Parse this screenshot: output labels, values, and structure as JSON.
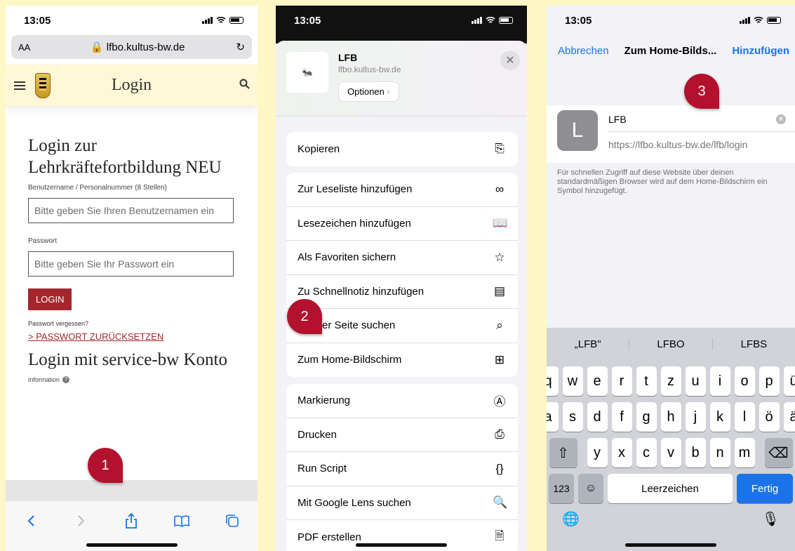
{
  "panel1": {
    "time": "13:05",
    "aa": "AA",
    "url": "lfbo.kultus-bw.de",
    "page_title": "Login",
    "heading": "Login zur Lehrkräftefortbildung NEU",
    "username_label": "Benutzername / Personalnummer (8 Stellen)",
    "username_placeholder": "Bitte geben Sie Ihren Benutzernamen ein",
    "password_label": "Passwort",
    "password_placeholder": "Bitte geben Sie Ihr Passwort ein",
    "login_button": "LOGIN",
    "forgot": "Passwort vergessen?",
    "reset_link": "> PASSWORT ZURÜCKSETZEN",
    "heading2": "Login mit service-bw Konto",
    "info": "Information",
    "badge": "1"
  },
  "panel2": {
    "time": "13:05",
    "site_title": "LFB",
    "site_url": "lfbo.kultus-bw.de",
    "options": "Optionen",
    "close": "✕",
    "group1": [
      {
        "label": "Kopieren",
        "icon": "copy-icon"
      }
    ],
    "group2": [
      {
        "label": "Zur Leseliste hinzufügen",
        "icon": "glasses-icon"
      },
      {
        "label": "Lesezeichen hinzufügen",
        "icon": "book-icon"
      },
      {
        "label": "Als Favoriten sichern",
        "icon": "star-icon"
      },
      {
        "label": "Zu Schnellnotiz hinzufügen",
        "icon": "quicknote-icon"
      },
      {
        "label": "Auf der Seite suchen",
        "icon": "find-icon"
      },
      {
        "label": "Zum Home-Bildschirm",
        "icon": "add-square-icon"
      }
    ],
    "group3": [
      {
        "label": "Markierung",
        "icon": "markup-icon"
      },
      {
        "label": "Drucken",
        "icon": "printer-icon"
      },
      {
        "label": "Run Script",
        "icon": "braces-icon"
      },
      {
        "label": "Mit Google Lens suchen",
        "icon": "search-icon"
      },
      {
        "label": "PDF erstellen",
        "icon": "document-icon"
      }
    ],
    "badge": "2"
  },
  "panel3": {
    "time": "13:05",
    "cancel": "Abbrechen",
    "title": "Zum Home-Bilds...",
    "add": "Hinzufügen",
    "icon_letter": "L",
    "name": "LFB",
    "url": "https://lfbo.kultus-bw.de/lfb/login",
    "hint": "Für schnellen Zugriff auf diese Website über deinen standardmäßigen Browser wird auf dem Home-Bildschirm ein Symbol hinzugefügt.",
    "suggestions": [
      "„LFB\"",
      "LFBO",
      "LFBS"
    ],
    "row1": [
      "q",
      "w",
      "e",
      "r",
      "t",
      "z",
      "u",
      "i",
      "o",
      "p",
      "ü"
    ],
    "row2": [
      "a",
      "s",
      "d",
      "f",
      "g",
      "h",
      "j",
      "k",
      "l",
      "ö",
      "ä"
    ],
    "row3": [
      "y",
      "x",
      "c",
      "v",
      "b",
      "n",
      "m"
    ],
    "numkey": "123",
    "space": "Leerzeichen",
    "done": "Fertig",
    "badge": "3"
  },
  "colors": {
    "accent": "#1a73e8",
    "badge": "#b3122f",
    "login": "#a4262c",
    "background": "#fff7c6"
  }
}
